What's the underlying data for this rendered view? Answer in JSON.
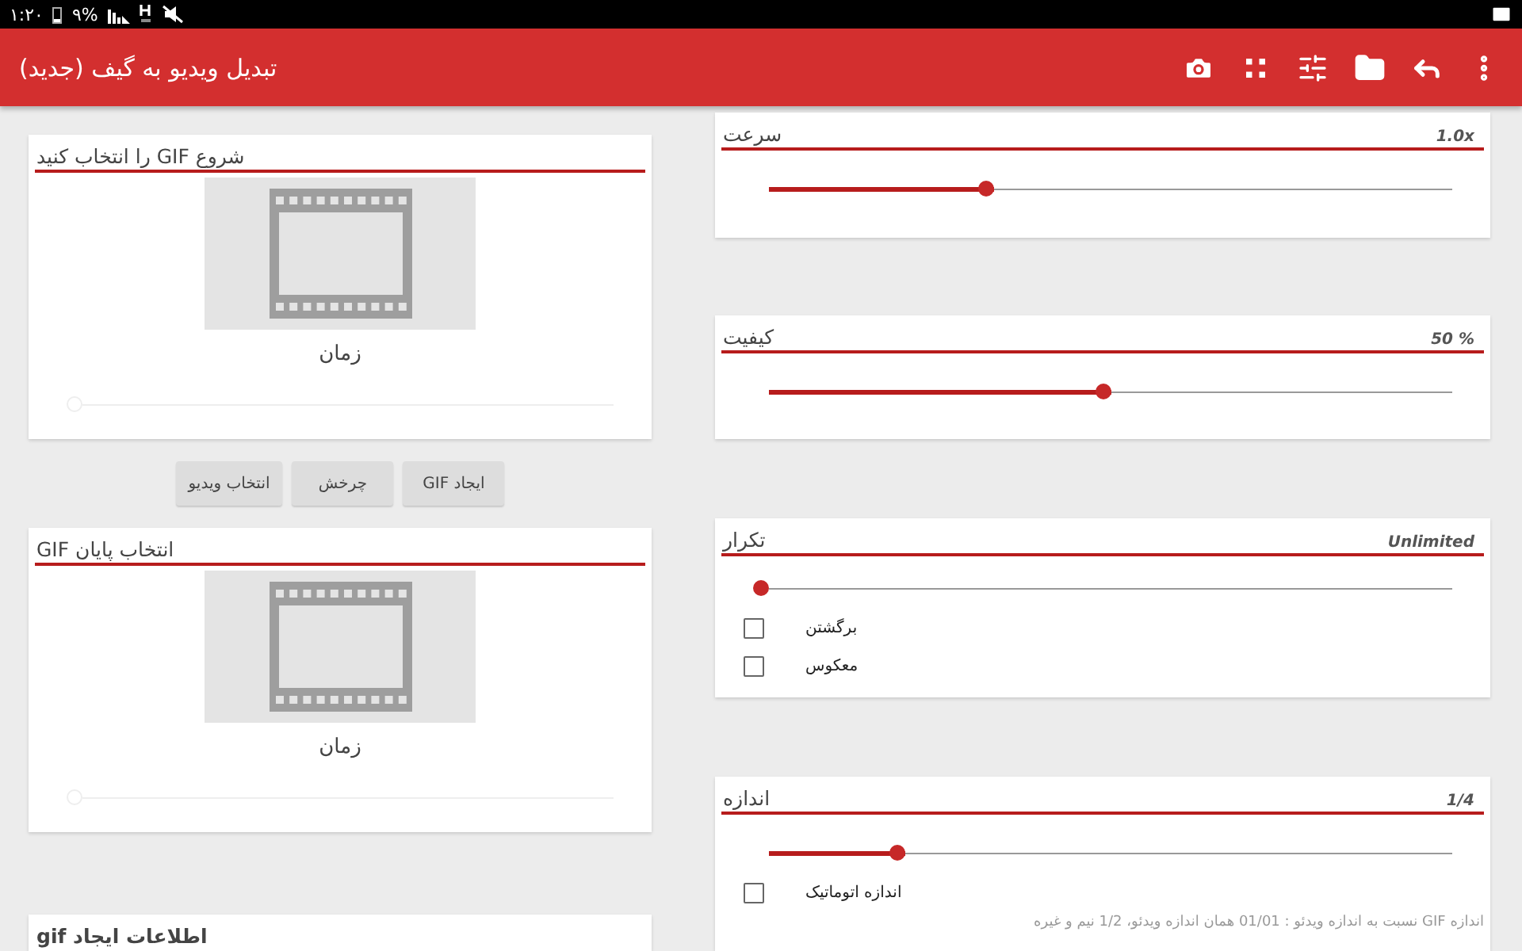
{
  "status_bar": {
    "time": "۱:۲۰",
    "battery": "۹%"
  },
  "toolbar": {
    "title": "تبدیل ویدیو به گیف (جدید)"
  },
  "start_card": {
    "title": "شروع GIF را انتخاب کنید",
    "time_label": "زمان",
    "timeline": {
      "level": 0
    }
  },
  "buttons": [
    "ایجاد GIF",
    "چرخش",
    "انتخاب ویدیو"
  ],
  "end_card": {
    "title": "انتخاب پایان GIF",
    "time_label": "زمان",
    "timeline": {
      "level": 0
    }
  },
  "info_card": {
    "title": "اطلاعات ایجاد gif"
  },
  "settings": [
    {
      "title": "سرعت",
      "value": "1.0x",
      "level": 0.33
    },
    {
      "title": "کیفیت",
      "value": "50 %",
      "level": 0.5
    },
    {
      "title": "تکرار",
      "value": "Unlimited",
      "level": 0,
      "options": [
        {
          "label": "برگشتن",
          "checked": false
        },
        {
          "label": "معکوس",
          "checked": false
        }
      ]
    },
    {
      "title": "اندازه",
      "value": "1/4",
      "level": 0.2,
      "options": [
        {
          "label": "اندازه اتوماتیک",
          "checked": false
        }
      ],
      "hint": "اندازه GIF نسبت به اندازه ویدئو : 01/01 همان اندازه ویدئو، 1/2 نیم و غیره"
    }
  ]
}
